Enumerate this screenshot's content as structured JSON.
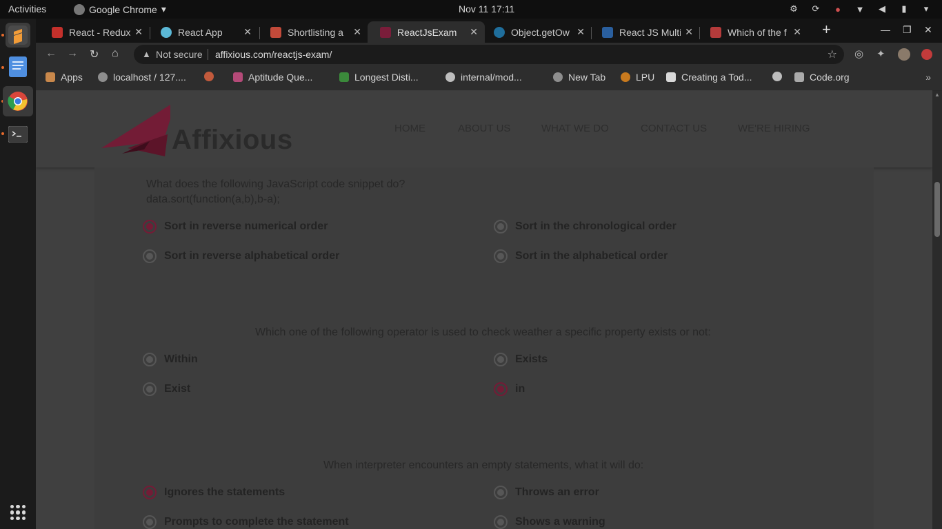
{
  "system": {
    "activities": "Activities",
    "app_name": "Google Chrome",
    "clock": "Nov 11  17:11"
  },
  "browser": {
    "tabs": [
      {
        "title": "React - Redux",
        "favicon_color": "#c4302b",
        "active": false
      },
      {
        "title": "React App",
        "favicon_color": "#5bb8d6",
        "active": false
      },
      {
        "title": "Shortlisting a",
        "favicon_color": "#c24a3a",
        "active": false
      },
      {
        "title": "ReactJsExam",
        "favicon_color": "#7a1d3a",
        "active": true
      },
      {
        "title": "Object.getOw",
        "favicon_color": "#1f6e9c",
        "active": false
      },
      {
        "title": "React JS Multi",
        "favicon_color": "#2a5f9e",
        "active": false
      },
      {
        "title": "Which of the f",
        "favicon_color": "#b53b3b",
        "active": false
      }
    ],
    "omnibox": {
      "security": "Not secure",
      "url": "affixious.com/reactjs-exam/"
    },
    "bookmarks": [
      {
        "label": "Apps",
        "color": "#c9884b"
      },
      {
        "label": "localhost / 127....",
        "color": "#8e8e8e"
      },
      {
        "label": "",
        "color": "#c25a3c"
      },
      {
        "label": "Aptitude Que...",
        "color": "#b44a78"
      },
      {
        "label": "Longest Disti...",
        "color": "#3b8a3b"
      },
      {
        "label": "internal/mod...",
        "color": "#bdbdbd"
      },
      {
        "label": "New Tab",
        "color": "#8e8e8e"
      },
      {
        "label": "LPU",
        "color": "#c97a1e"
      },
      {
        "label": "Creating a Tod...",
        "color": "#d8d8d8"
      },
      {
        "label": "",
        "color": "#bdbdbd"
      },
      {
        "label": "Code.org",
        "color": "#aaaaaa"
      }
    ]
  },
  "site": {
    "brand": "Affixious",
    "brand_color": "#731c36",
    "nav": [
      "HOME",
      "ABOUT US",
      "WHAT WE DO",
      "CONTACT US",
      "WE'RE HIRING"
    ]
  },
  "questions": [
    {
      "text_line1": "What does the following JavaScript code snippet do?",
      "text_line2": "data.sort(function(a,b),b-a);",
      "options": [
        {
          "label": "Sort in reverse numerical order",
          "checked": true
        },
        {
          "label": "Sort in the chronological order",
          "checked": false
        },
        {
          "label": "Sort in reverse alphabetical order",
          "checked": false
        },
        {
          "label": "Sort in the alphabetical order",
          "checked": false
        }
      ]
    },
    {
      "text_line1": "Which one of the following operator is used to check weather a specific property exists or not:",
      "options": [
        {
          "label": "Within",
          "checked": false
        },
        {
          "label": "Exists",
          "checked": false
        },
        {
          "label": "Exist",
          "checked": false
        },
        {
          "label": "in",
          "checked": true
        }
      ]
    },
    {
      "text_line1": "When interpreter encounters an empty statements, what it will do:",
      "options": [
        {
          "label": "Ignores the statements",
          "checked": true
        },
        {
          "label": "Throws an error",
          "checked": false
        },
        {
          "label": "Prompts to complete the statement",
          "checked": false
        },
        {
          "label": "Shows a warning",
          "checked": false
        }
      ]
    }
  ]
}
